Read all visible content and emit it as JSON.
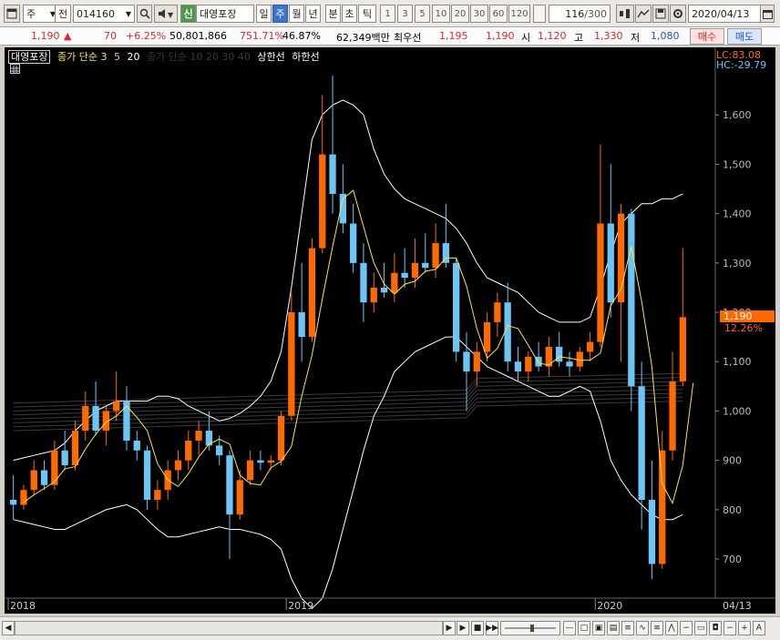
{
  "toolbar": {
    "market_label": "주",
    "view_label": "전",
    "stock_code": "014160",
    "stock_badge": "신",
    "stock_name": "대영포장",
    "periods": [
      "일",
      "주",
      "월",
      "년"
    ],
    "intraday": [
      "분",
      "초",
      "틱"
    ],
    "intervals": [
      "1",
      "3",
      "5",
      "10",
      "20",
      "30",
      "60",
      "120"
    ],
    "count_value": "116",
    "count_total": "/300",
    "date_value": "2020/04/13"
  },
  "quote": {
    "price": "1,190",
    "change_arrow": "▲",
    "change": "70",
    "change_pct": "+6.25%",
    "volume": "50,801,866",
    "volume_ratio": "751.71%",
    "turnover": "46.87%",
    "trade_value": "62,349백만",
    "best_ask_label": "최우선",
    "best_ask": "1,195",
    "best_bid": "1,190",
    "open_label": "시",
    "open": "1,120",
    "high_label": "고",
    "high": "1,330",
    "low_label": "저",
    "low": "1,080",
    "buy_label": "매수",
    "sell_label": "매도"
  },
  "legend": {
    "name": "대영포장",
    "ma_label": "종가 단순 3",
    "ma5": "5",
    "ma20": "20",
    "ma_long": "종가 단순 10 20 30 40",
    "upper_label": "상한선",
    "lower_label": "하한선"
  },
  "chart_data": {
    "type": "candlestick",
    "ylim": [
      630,
      1700
    ],
    "y_ticks": [
      700,
      800,
      900,
      1000,
      1100,
      1200,
      1300,
      1400,
      1500,
      1600
    ],
    "x_labels": [
      "2018",
      "2019",
      "2020",
      "04/13"
    ],
    "lc_label": "LC:83.08",
    "hc_label": "HC:-29.79",
    "last_price_label": "1,190",
    "last_pct_label": "12.26%",
    "colors": {
      "up": "#ff6a00",
      "down": "#6cc6f5",
      "ma3": "#ffe14a",
      "ma5": "#ffb0b0",
      "ma20": "#ffffff",
      "band": "#ffffff"
    },
    "candles": [
      {
        "o": 820,
        "h": 870,
        "l": 780,
        "c": 810
      },
      {
        "o": 810,
        "h": 850,
        "l": 800,
        "c": 840
      },
      {
        "o": 840,
        "h": 900,
        "l": 830,
        "c": 880
      },
      {
        "o": 880,
        "h": 900,
        "l": 840,
        "c": 850
      },
      {
        "o": 850,
        "h": 940,
        "l": 840,
        "c": 920
      },
      {
        "o": 920,
        "h": 960,
        "l": 880,
        "c": 890
      },
      {
        "o": 890,
        "h": 980,
        "l": 880,
        "c": 960
      },
      {
        "o": 960,
        "h": 1040,
        "l": 940,
        "c": 1010
      },
      {
        "o": 1010,
        "h": 1060,
        "l": 950,
        "c": 960
      },
      {
        "o": 960,
        "h": 1010,
        "l": 930,
        "c": 1000
      },
      {
        "o": 1000,
        "h": 1080,
        "l": 980,
        "c": 1020
      },
      {
        "o": 1020,
        "h": 1050,
        "l": 920,
        "c": 940
      },
      {
        "o": 940,
        "h": 960,
        "l": 900,
        "c": 920
      },
      {
        "o": 920,
        "h": 930,
        "l": 800,
        "c": 820
      },
      {
        "o": 820,
        "h": 860,
        "l": 800,
        "c": 840
      },
      {
        "o": 840,
        "h": 900,
        "l": 820,
        "c": 880
      },
      {
        "o": 880,
        "h": 920,
        "l": 860,
        "c": 900
      },
      {
        "o": 900,
        "h": 960,
        "l": 880,
        "c": 940
      },
      {
        "o": 940,
        "h": 980,
        "l": 910,
        "c": 960
      },
      {
        "o": 960,
        "h": 1000,
        "l": 920,
        "c": 930
      },
      {
        "o": 930,
        "h": 950,
        "l": 890,
        "c": 910
      },
      {
        "o": 910,
        "h": 920,
        "l": 700,
        "c": 790
      },
      {
        "o": 790,
        "h": 880,
        "l": 780,
        "c": 860
      },
      {
        "o": 860,
        "h": 920,
        "l": 850,
        "c": 900
      },
      {
        "o": 900,
        "h": 920,
        "l": 880,
        "c": 895
      },
      {
        "o": 895,
        "h": 910,
        "l": 880,
        "c": 900
      },
      {
        "o": 900,
        "h": 1000,
        "l": 890,
        "c": 990
      },
      {
        "o": 990,
        "h": 1240,
        "l": 980,
        "c": 1200
      },
      {
        "o": 1200,
        "h": 1300,
        "l": 1100,
        "c": 1150
      },
      {
        "o": 1150,
        "h": 1350,
        "l": 1140,
        "c": 1330
      },
      {
        "o": 1330,
        "h": 1640,
        "l": 1320,
        "c": 1520
      },
      {
        "o": 1520,
        "h": 1680,
        "l": 1400,
        "c": 1440
      },
      {
        "o": 1440,
        "h": 1500,
        "l": 1360,
        "c": 1380
      },
      {
        "o": 1380,
        "h": 1420,
        "l": 1280,
        "c": 1300
      },
      {
        "o": 1300,
        "h": 1340,
        "l": 1180,
        "c": 1220
      },
      {
        "o": 1220,
        "h": 1280,
        "l": 1200,
        "c": 1250
      },
      {
        "o": 1250,
        "h": 1300,
        "l": 1230,
        "c": 1240
      },
      {
        "o": 1240,
        "h": 1320,
        "l": 1220,
        "c": 1280
      },
      {
        "o": 1280,
        "h": 1330,
        "l": 1250,
        "c": 1270
      },
      {
        "o": 1270,
        "h": 1350,
        "l": 1250,
        "c": 1300
      },
      {
        "o": 1300,
        "h": 1360,
        "l": 1280,
        "c": 1290
      },
      {
        "o": 1290,
        "h": 1380,
        "l": 1270,
        "c": 1340
      },
      {
        "o": 1340,
        "h": 1420,
        "l": 1290,
        "c": 1300
      },
      {
        "o": 1300,
        "h": 1310,
        "l": 1100,
        "c": 1120
      },
      {
        "o": 1120,
        "h": 1160,
        "l": 1000,
        "c": 1080
      },
      {
        "o": 1080,
        "h": 1140,
        "l": 1050,
        "c": 1120
      },
      {
        "o": 1120,
        "h": 1200,
        "l": 1100,
        "c": 1180
      },
      {
        "o": 1180,
        "h": 1240,
        "l": 1150,
        "c": 1220
      },
      {
        "o": 1220,
        "h": 1260,
        "l": 1080,
        "c": 1100
      },
      {
        "o": 1100,
        "h": 1130,
        "l": 1060,
        "c": 1080
      },
      {
        "o": 1080,
        "h": 1120,
        "l": 1060,
        "c": 1110
      },
      {
        "o": 1110,
        "h": 1140,
        "l": 1080,
        "c": 1090
      },
      {
        "o": 1090,
        "h": 1150,
        "l": 1070,
        "c": 1130
      },
      {
        "o": 1130,
        "h": 1160,
        "l": 1090,
        "c": 1100
      },
      {
        "o": 1100,
        "h": 1120,
        "l": 1070,
        "c": 1090
      },
      {
        "o": 1090,
        "h": 1130,
        "l": 1080,
        "c": 1120
      },
      {
        "o": 1120,
        "h": 1160,
        "l": 1100,
        "c": 1140
      },
      {
        "o": 1140,
        "h": 1540,
        "l": 1130,
        "c": 1380
      },
      {
        "o": 1380,
        "h": 1500,
        "l": 1190,
        "c": 1220
      },
      {
        "o": 1220,
        "h": 1420,
        "l": 1100,
        "c": 1400
      },
      {
        "o": 1400,
        "h": 1410,
        "l": 1000,
        "c": 1050
      },
      {
        "o": 1050,
        "h": 1100,
        "l": 760,
        "c": 820
      },
      {
        "o": 820,
        "h": 900,
        "l": 660,
        "c": 690
      },
      {
        "o": 690,
        "h": 960,
        "l": 680,
        "c": 920
      },
      {
        "o": 920,
        "h": 1120,
        "l": 900,
        "c": 1060
      },
      {
        "o": 1060,
        "h": 1330,
        "l": 1050,
        "c": 1190
      }
    ],
    "ma3": [
      815,
      830,
      843,
      857,
      883,
      887,
      923,
      953,
      977,
      990,
      1010,
      987,
      960,
      893,
      860,
      847,
      873,
      907,
      933,
      943,
      933,
      870,
      853,
      850,
      885,
      898,
      928,
      1030,
      1113,
      1227,
      1333,
      1430,
      1447,
      1373,
      1300,
      1257,
      1237,
      1257,
      1263,
      1283,
      1287,
      1310,
      1310,
      1253,
      1167,
      1107,
      1127,
      1173,
      1167,
      1133,
      1097,
      1093,
      1110,
      1107,
      1103,
      1103,
      1117,
      1213,
      1247,
      1333,
      1223,
      1090,
      853,
      813,
      890,
      1057
    ],
    "upper": [
      900,
      905,
      910,
      915,
      920,
      935,
      960,
      980,
      1000,
      1010,
      1020,
      1020,
      1020,
      1020,
      1030,
      1030,
      1025,
      1010,
      1000,
      990,
      980,
      985,
      995,
      1010,
      1030,
      1060,
      1120,
      1250,
      1400,
      1550,
      1600,
      1620,
      1630,
      1620,
      1600,
      1530,
      1480,
      1450,
      1430,
      1420,
      1410,
      1400,
      1390,
      1370,
      1340,
      1300,
      1270,
      1260,
      1250,
      1240,
      1220,
      1200,
      1190,
      1180,
      1180,
      1180,
      1190,
      1250,
      1320,
      1380,
      1400,
      1420,
      1420,
      1430,
      1430,
      1440
    ],
    "lower": [
      780,
      775,
      770,
      765,
      760,
      760,
      770,
      780,
      790,
      800,
      805,
      810,
      800,
      780,
      760,
      745,
      745,
      750,
      755,
      760,
      765,
      760,
      760,
      755,
      750,
      740,
      720,
      660,
      620,
      600,
      620,
      680,
      760,
      840,
      920,
      990,
      1030,
      1080,
      1100,
      1120,
      1130,
      1140,
      1150,
      1150,
      1130,
      1110,
      1090,
      1080,
      1070,
      1060,
      1050,
      1040,
      1030,
      1030,
      1040,
      1050,
      1040,
      980,
      900,
      860,
      830,
      810,
      790,
      780,
      780,
      790
    ]
  }
}
